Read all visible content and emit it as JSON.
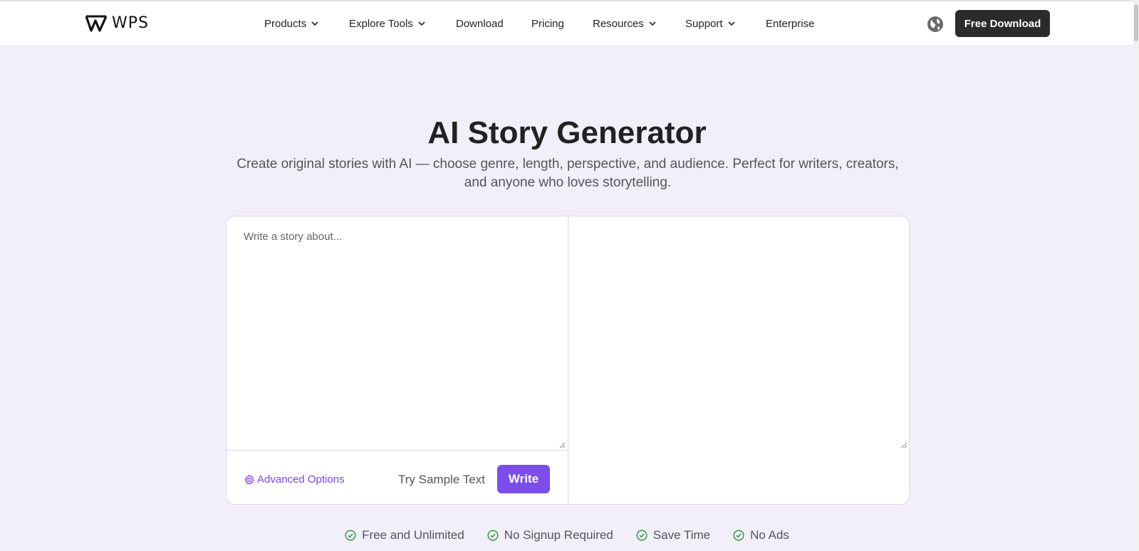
{
  "header": {
    "logo_text": "WPS",
    "nav": [
      {
        "label": "Products",
        "dropdown": true
      },
      {
        "label": "Explore Tools",
        "dropdown": true
      },
      {
        "label": "Download",
        "dropdown": false
      },
      {
        "label": "Pricing",
        "dropdown": false
      },
      {
        "label": "Resources",
        "dropdown": true
      },
      {
        "label": "Support",
        "dropdown": true
      },
      {
        "label": "Enterprise",
        "dropdown": false
      }
    ],
    "language_icon": "globe-icon",
    "cta_label": "Free Download"
  },
  "hero": {
    "title": "AI Story Generator",
    "subtitle": "Create original stories with AI — choose genre, length, perspective, and audience. Perfect for writers, creators, and anyone who loves storytelling."
  },
  "editor": {
    "input_placeholder": "Write a story about...",
    "input_value": "",
    "output_value": "",
    "advanced_label": "Advanced Options",
    "sample_label": "Try Sample Text",
    "write_label": "Write"
  },
  "features": [
    {
      "label": "Free and Unlimited"
    },
    {
      "label": "No Signup Required"
    },
    {
      "label": "Save Time"
    },
    {
      "label": "No Ads"
    }
  ],
  "colors": {
    "accent": "#7c4dea",
    "accent_text": "#7b46e8",
    "page_bg": "#f2effb",
    "cta_bg": "#2b2b2b",
    "check": "#3a9a3a"
  }
}
